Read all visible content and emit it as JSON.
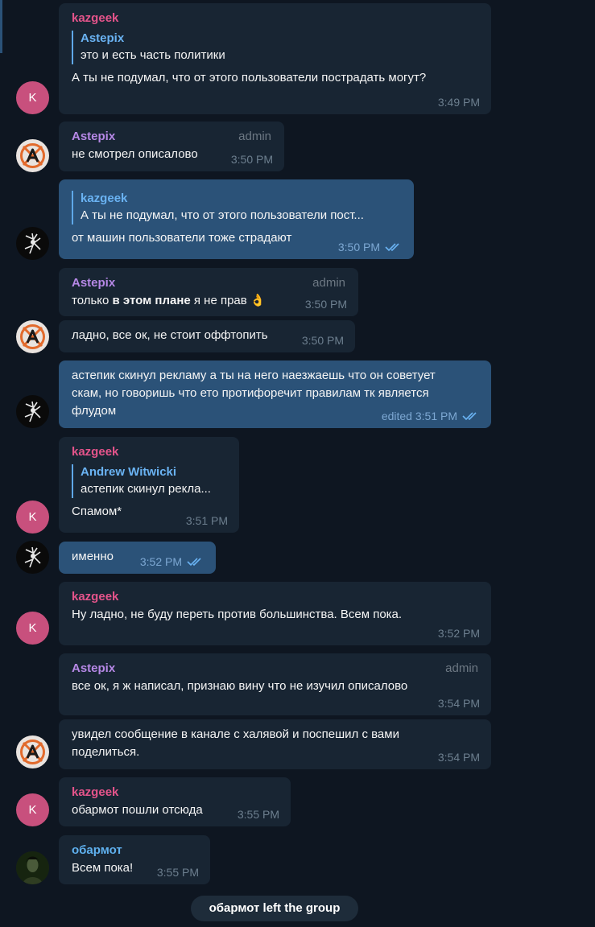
{
  "messages": [
    {
      "sender": "kazgeek",
      "reply_name": "Astepix",
      "reply_text": "это и есть часть политики",
      "text": "А ты не подумал, что от этого пользователи пострадать могут?",
      "time": "3:49 PM"
    },
    {
      "sender": "Astepix",
      "role": "admin",
      "text": "не смотрел описалово",
      "time": "3:50 PM"
    },
    {
      "reply_name": "kazgeek",
      "reply_text": "А ты не подумал, что от этого пользователи пост...",
      "text": "от машин пользователи тоже страдают",
      "time": "3:50 PM"
    },
    {
      "sender": "Astepix",
      "role": "admin",
      "text_before": "только ",
      "text_bold": "в этом плане",
      "text_after": " я не прав",
      "emoji": "👌",
      "time": "3:50 PM"
    },
    {
      "text": "ладно, все ок, не стоит оффтопить",
      "time": "3:50 PM"
    },
    {
      "text": "астепик скинул рекламу а ты на него наезжаешь что он советует скам, но говоришь что ето протифоречит правилам тк является флудом",
      "time": "edited 3:51 PM"
    },
    {
      "sender": "kazgeek",
      "reply_name": "Andrew Witwicki",
      "reply_text": "астепик скинул рекла...",
      "text": "Спамом*",
      "time": "3:51 PM"
    },
    {
      "text": "именно",
      "time": "3:52 PM"
    },
    {
      "sender": "kazgeek",
      "text": "Ну ладно, не буду переть против большинства. Всем пока.",
      "time": "3:52 PM"
    },
    {
      "sender": "Astepix",
      "role": "admin",
      "text": "все ок, я ж написал, признаю вину что не изучил описалово",
      "time": "3:54 PM"
    },
    {
      "text": "увидел сообщение в канале с халявой и поспешил с вами поделиться.",
      "time": "3:54 PM"
    },
    {
      "sender": "kazgeek",
      "text": "обармот пошли отсюда",
      "time": "3:55 PM"
    },
    {
      "sender": "обармот",
      "text": "Всем пока!",
      "time": "3:55 PM"
    }
  ],
  "avatars": {
    "kazgeek_letter": "K"
  },
  "service_message": "обармот left the group",
  "colors": {
    "background": "#0e1621",
    "incoming": "#182533",
    "outgoing": "#2b5278",
    "kazgeek": "#e5548b",
    "astepix": "#b688e6",
    "obarmot": "#5fb0ee"
  },
  "icons": {
    "read_receipt": "double-check-icon"
  }
}
